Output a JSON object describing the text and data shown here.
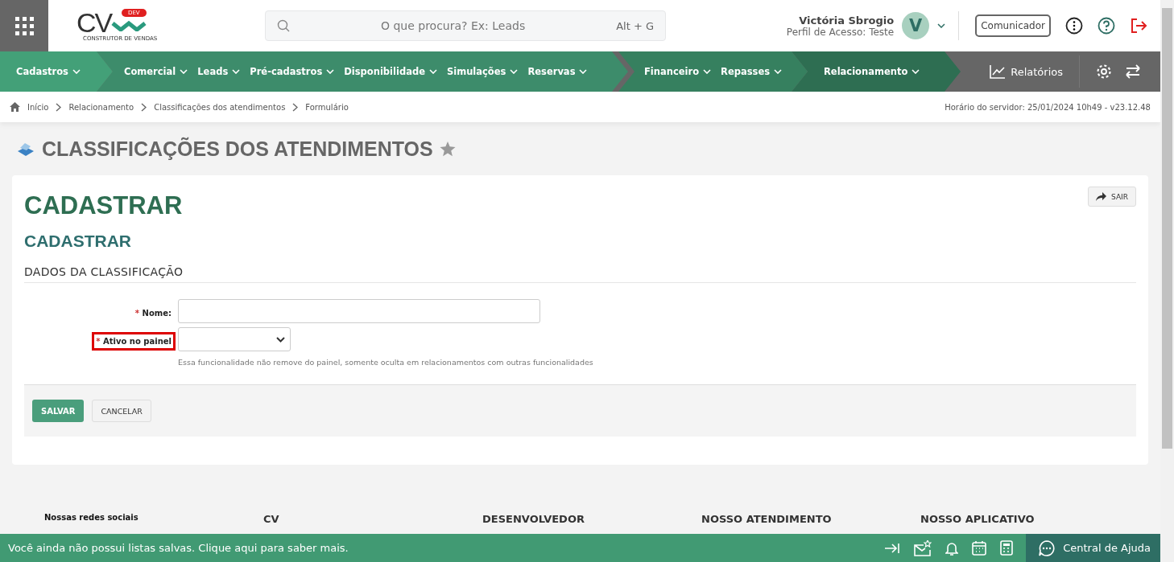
{
  "header": {
    "logo": {
      "letters": "CV",
      "badge": "DEV",
      "tagline": "CONSTRUTOR DE VENDAS"
    },
    "search": {
      "placeholder": "O que procura? Ex: Leads",
      "shortcut": "Alt + G"
    },
    "user": {
      "name": "Victória Sbrogio",
      "profile": "Perfil de Acesso: Teste",
      "initial": "V"
    },
    "communicator": "Comunicador"
  },
  "nav": {
    "groups": [
      {
        "color": "#43a078",
        "items": [
          "Cadastros"
        ]
      },
      {
        "color": "#3d8c6b",
        "items": [
          "Comercial",
          "Leads",
          "Pré-cadastros",
          "Disponibilidade",
          "Simulações",
          "Reservas"
        ]
      },
      {
        "color": "#36805f",
        "items": [
          "Financeiro",
          "Repasses"
        ]
      },
      {
        "color": "#2e6e52",
        "items": [
          "Relacionamento"
        ]
      }
    ],
    "reports": "Relatórios"
  },
  "breadcrumb": {
    "items": [
      "Início",
      "Relacionamento",
      "Classificações dos atendimentos",
      "Formulário"
    ],
    "server_time": "Horário do servidor: 25/01/2024 10h49 - v23.12.48"
  },
  "page_title": "CLASSIFICAÇÕES DOS ATENDIMENTOS",
  "card": {
    "title": "CADASTRAR",
    "exit_button": "SAIR",
    "subtitle": "CADASTRAR",
    "section": "DADOS DA CLASSIFICAÇÃO",
    "fields": [
      {
        "kind": "text",
        "required_mark": "*",
        "label": "Nome:",
        "highlighted": false
      },
      {
        "kind": "select",
        "required_mark": "*",
        "label": "Ativo no painel",
        "highlighted": true,
        "help": "Essa funcionalidade não remove do painel, somente oculta em relacionamentos com outras funcionalidades"
      }
    ],
    "buttons": [
      {
        "label": "SALVAR",
        "kind": "primary"
      },
      {
        "label": "CANCELAR",
        "kind": "secondary"
      }
    ]
  },
  "footer": {
    "columns": [
      "Nossas redes sociais",
      "CV",
      "DESENVOLVEDOR",
      "NOSSO ATENDIMENTO",
      "NOSSO APLICATIVO"
    ]
  },
  "bottom_bar": {
    "message": "Você ainda não possui listas salvas. Clique aqui para saber mais.",
    "help": "Central de Ajuda"
  }
}
